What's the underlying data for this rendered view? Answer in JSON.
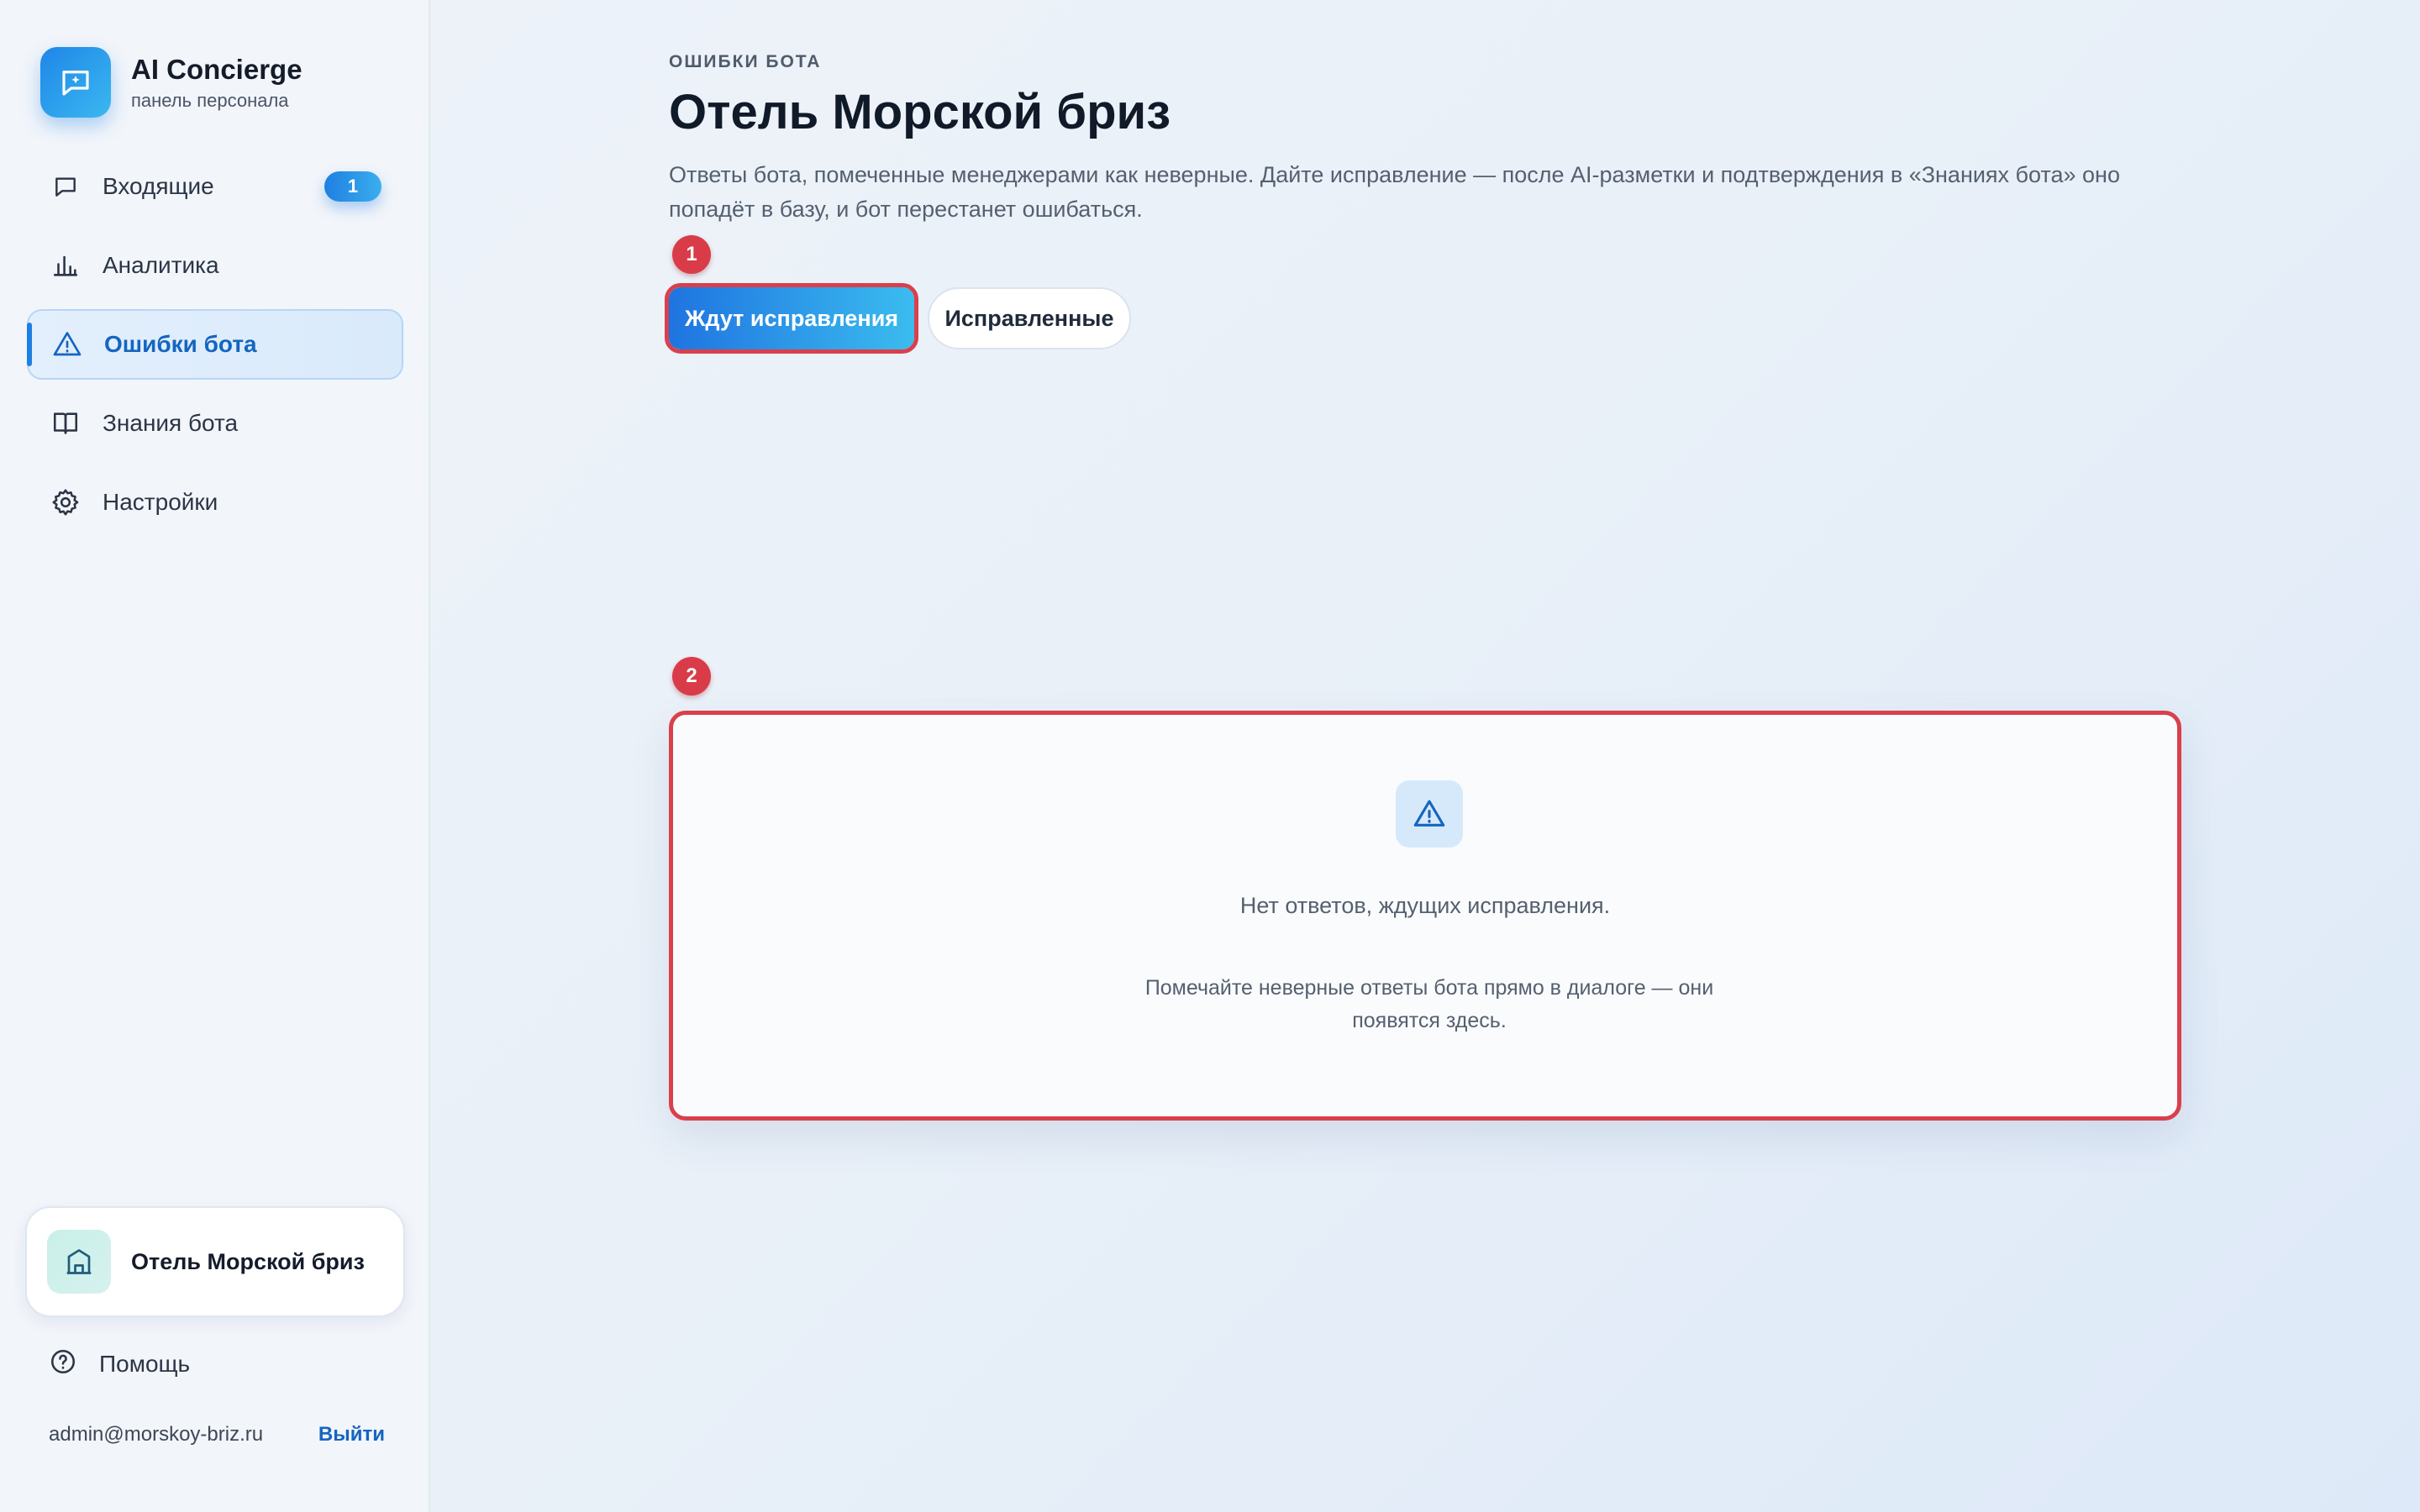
{
  "app": {
    "title": "AI Concierge",
    "subtitle": "панель персонала",
    "logo_icon": "chat-sparkle-icon"
  },
  "sidebar": {
    "items": [
      {
        "label": "Входящие",
        "icon": "chat-icon",
        "badge": "1"
      },
      {
        "label": "Аналитика",
        "icon": "bar-chart-icon"
      },
      {
        "label": "Ошибки бота",
        "icon": "warning-icon",
        "active": true
      },
      {
        "label": "Знания бота",
        "icon": "book-icon"
      },
      {
        "label": "Настройки",
        "icon": "gear-icon"
      }
    ],
    "hotel": {
      "name": "Отель Морской бриз",
      "icon": "building-icon"
    },
    "help_label": "Помощь",
    "user_email": "admin@morskoy-briz.ru",
    "logout_label": "Выйти"
  },
  "main": {
    "eyebrow": "ОШИБКИ БОТА",
    "title": "Отель Морской бриз",
    "description": "Ответы бота, помеченные менеджерами как неверные. Дайте исправление — после AI-разметки и подтверждения в «Знаниях бота» оно попадёт в базу, и бот перестанет ошибаться.",
    "tabs": [
      {
        "label": "Ждут исправления",
        "active": true
      },
      {
        "label": "Исправленные",
        "active": false
      }
    ],
    "empty_state": {
      "icon": "warning-icon",
      "title": "Нет ответов, ждущих исправления.",
      "hint": "Помечайте неверные ответы бота прямо в диалоге — они появятся здесь."
    }
  },
  "annotations": {
    "marker_1": "1",
    "marker_2": "2"
  },
  "colors": {
    "accent": "#1f7fe2",
    "annotation_red": "#d9404b",
    "sidebar_bg": "#f2f5fa"
  }
}
